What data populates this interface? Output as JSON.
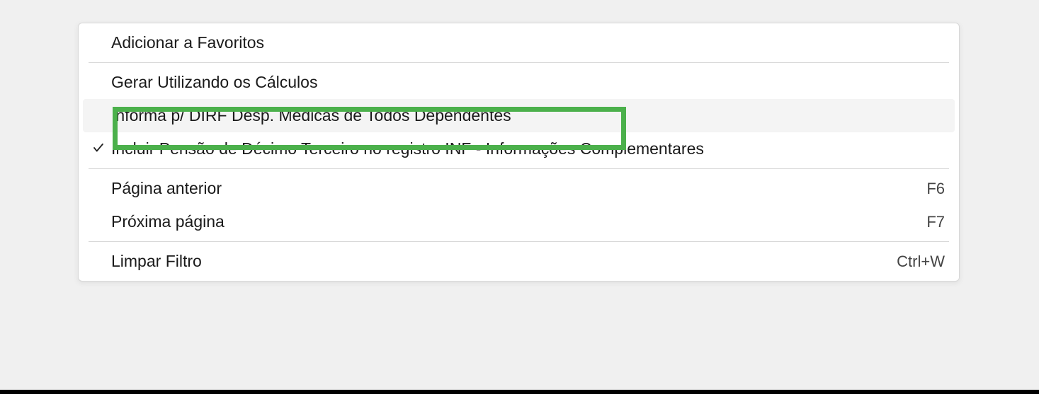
{
  "menu": {
    "items": [
      {
        "label": "Adicionar a Favoritos",
        "checked": false,
        "shortcut": ""
      },
      {
        "label": "Gerar Utilizando os Cálculos",
        "checked": false,
        "shortcut": ""
      },
      {
        "label": "Informa p/ DIRF Desp. Médicas de Todos Dependentes",
        "checked": false,
        "shortcut": ""
      },
      {
        "label": "Incluir Pensão de Décimo Terceiro no  registro INF - Informações Complementares",
        "checked": true,
        "shortcut": ""
      },
      {
        "label": "Página anterior",
        "checked": false,
        "shortcut": "F6"
      },
      {
        "label": "Próxima página",
        "checked": false,
        "shortcut": "F7"
      },
      {
        "label": "Limpar Filtro",
        "checked": false,
        "shortcut": "Ctrl+W"
      }
    ]
  }
}
